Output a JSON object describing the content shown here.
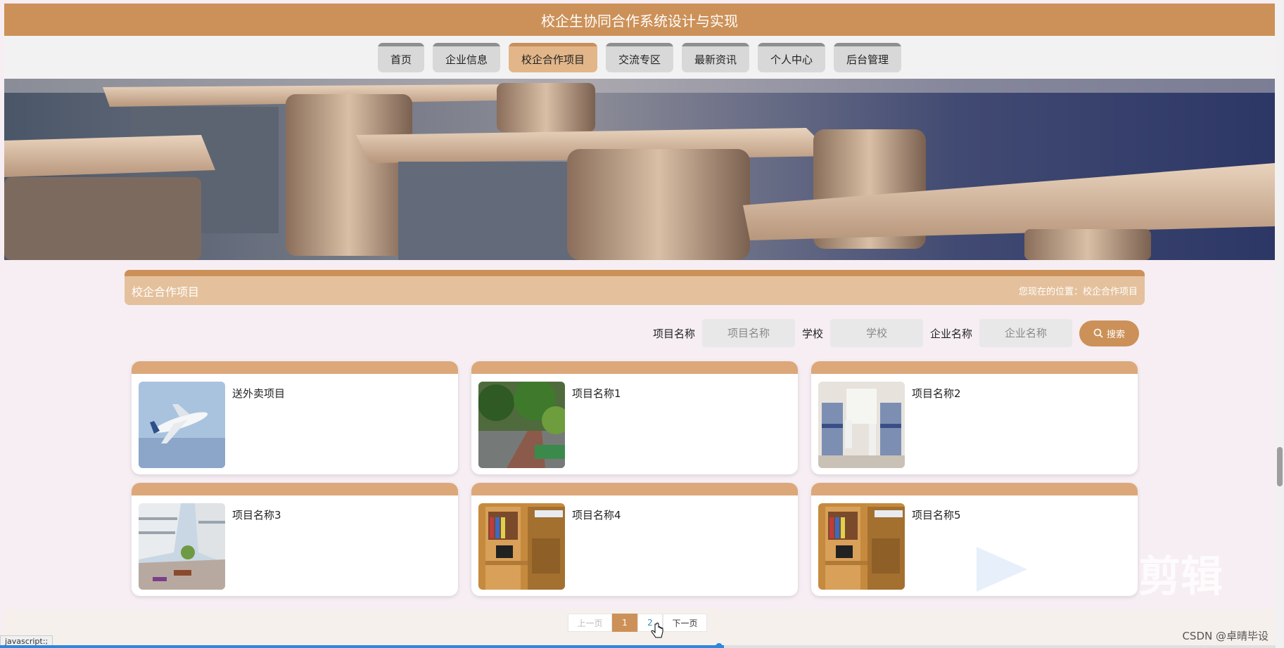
{
  "header": {
    "title": "校企生协同合作系统设计与实现"
  },
  "nav": {
    "items": [
      {
        "label": "首页"
      },
      {
        "label": "企业信息"
      },
      {
        "label": "校企合作项目"
      },
      {
        "label": "交流专区"
      },
      {
        "label": "最新资讯"
      },
      {
        "label": "个人中心"
      },
      {
        "label": "后台管理"
      }
    ],
    "active_index": 2
  },
  "section": {
    "title": "校企合作项目",
    "breadcrumb": "您现在的位置：校企合作项目"
  },
  "search": {
    "fields": [
      {
        "label": "项目名称",
        "placeholder": "项目名称"
      },
      {
        "label": "学校",
        "placeholder": "学校"
      },
      {
        "label": "企业名称",
        "placeholder": "企业名称"
      }
    ],
    "button_label": "搜索"
  },
  "projects": [
    {
      "name": "送外卖项目",
      "image": "airplane"
    },
    {
      "name": "项目名称1",
      "image": "garden"
    },
    {
      "name": "项目名称2",
      "image": "dormitory"
    },
    {
      "name": "项目名称3",
      "image": "campus"
    },
    {
      "name": "项目名称4",
      "image": "dorm-desk"
    },
    {
      "name": "项目名称5",
      "image": "dorm-desk"
    }
  ],
  "pagination": {
    "prev_label": "上一页",
    "pages": [
      "1",
      "2"
    ],
    "current": "1",
    "next_label": "下一页"
  },
  "status_bar": {
    "text": "javascript:;"
  },
  "watermark": {
    "text": "CSDN @卓晴毕设"
  },
  "overlay": {
    "text": "剪辑"
  },
  "colors": {
    "primary": "#cc9158",
    "accent_light": "#e4c19c",
    "background": "#f6eef3"
  }
}
